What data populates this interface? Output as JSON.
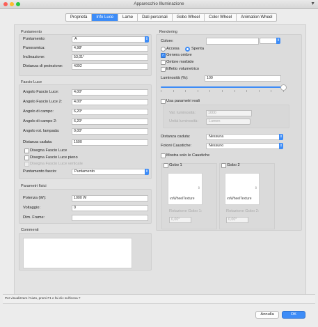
{
  "window": {
    "title": "Apparecchio Illuminazione"
  },
  "tabs": [
    "Proprietà",
    "Info Luce",
    "Lame",
    "Dati personali",
    "Gobo Wheel",
    "Color Wheel",
    "Animation Wheel"
  ],
  "puntamento": {
    "title": "Puntamento",
    "rows": [
      {
        "label": "Puntamento:",
        "value": "A"
      },
      {
        "label": "Panoramica:",
        "value": "4,98°"
      },
      {
        "label": "Inclinazione:",
        "value": "53,01°"
      },
      {
        "label": "Distanza di proiezione:",
        "value": "4392"
      }
    ]
  },
  "fascio": {
    "title": "Fascio Luce",
    "rows": [
      {
        "label": "Angolo Fascio Luce:",
        "value": "4,00°"
      },
      {
        "label": "Angolo Fascio Luce 2:",
        "value": "4,00°"
      },
      {
        "label": "Angolo di campo:",
        "value": "6,20°"
      },
      {
        "label": "Angolo di campo 2:",
        "value": "6,20°"
      },
      {
        "label": "Angolo rot. lampada:",
        "value": "0,00°"
      },
      {
        "label": "Distanza caduta:",
        "value": "1500"
      }
    ],
    "checks": [
      "Disegna Fascio Luce",
      "Disegna Fascio Luce pieno",
      "Disegna Fascio Luce verticale"
    ],
    "puntamento_label": "Puntamento fascio:",
    "puntamento_value": "Puntamento"
  },
  "fisici": {
    "title": "Parametri fisici",
    "rows": [
      {
        "label": "Potenza (W):",
        "value": "1000 W"
      },
      {
        "label": "Voltaggio:",
        "value": "0"
      },
      {
        "label": "Dim. Frame:",
        "value": ""
      }
    ]
  },
  "commenti": {
    "title": "Commenti"
  },
  "rendering": {
    "title": "Rendering",
    "colore_label": "Colore:",
    "accesa": "Accesa",
    "spenta": "Spenta",
    "genera_ombre": "Genera ombre",
    "ombre_morbide": "Ombre morbide",
    "effetto_volumetrico": "Effetto volumetrico",
    "luminosita_label": "Luminosità (%):",
    "luminosita_value": "100",
    "luminosita_level": 1.0,
    "usa_parametri": "Usa parametri reali",
    "val_lum_label": "Val. luminosità:",
    "val_lum_value": "1000",
    "unita_label": "Unità luminosità:",
    "unita_value": "Lumen",
    "distanza_label": "Distanza caduta:",
    "distanza_value": "Nessuna",
    "fotoni_label": "Fotoni Caustiche:",
    "fotoni_value": "Nessuno",
    "mostra_caustiche": "Mostra solo le Caustiche",
    "gobo1": {
      "label": "Gobo 1",
      "texture": "vsWheelTexture",
      "rot_label": "Rotazione Gobo 1:",
      "rot_value": "0,00°"
    },
    "gobo2": {
      "label": "Gobo 2",
      "texture": "vsWheelTexture",
      "rot_label": "Rotazione Gobo 2:",
      "rot_value": "0,00°"
    }
  },
  "status": {
    "text": "Per visualizzare l'Aiuto, premi F1 e fai clic sull'icona ?"
  },
  "buttons": {
    "cancel": "Annulla",
    "ok": "OK"
  },
  "colors": {
    "accent": "#3d8cf7",
    "close": "#fc5f57",
    "minimize": "#fdbc2e",
    "zoom": "#28c840"
  }
}
